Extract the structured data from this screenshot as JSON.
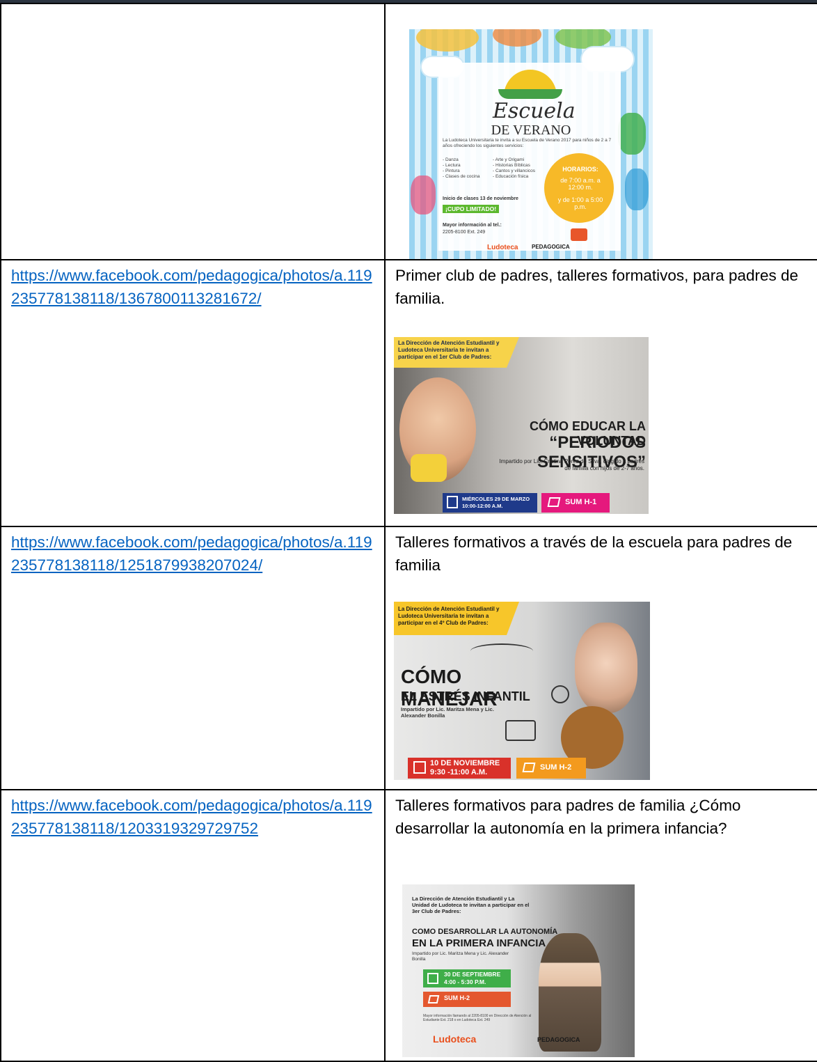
{
  "rows": [
    {
      "link": "",
      "description": "",
      "poster": {
        "kind": "escuela-verano",
        "script_title": "Escuela",
        "title": "DE VERANO",
        "intro": "La Ludoteca Universitaria te invita a su Escuela de Verano 2017 para niños de 2 a 7 años ofreciendo los siguientes servicios:",
        "services_left": [
          "- Danza",
          "- Lectura",
          "- Pintura",
          "- Clases de cocina"
        ],
        "services_right": [
          "- Arte y Origami",
          "- Historias Bíblicas",
          "- Cantos y villancicos",
          "- Educación física"
        ],
        "horarios_label": "HORARIOS:",
        "horarios_1": "de 7:00 a.m. a 12:00 m.",
        "horarios_2": "y de 1:00 a 5:00 p.m.",
        "start": "Inicio de clases 13 de noviembre",
        "limited": "¡CUPO LIMITADO!",
        "info_label": "Mayor información al tel.:",
        "info_phone": "2205-8100 Ext. 249",
        "logo_ludoteca": "Ludoteca",
        "logo_pedagogica": "PEDAGOGICA"
      }
    },
    {
      "link": "https://www.facebook.com/pedagogica/photos/a.119235778138118/1367800113281672/",
      "description": "Primer club de padres, talleres formativos, para padres de familia.",
      "poster": {
        "kind": "club-1",
        "banner": "La Dirección de Atención Estudiantil y Ludoteca Universitaria te invitan a participar en el 1er Club de Padres:",
        "headline1": "CÓMO EDUCAR LA VOLUNTAD",
        "headline2": "“PERIODOS SENSITIVOS”",
        "byline": "Impartido por Lic. Cristina Pérez de Silva, dirigido a padres de familia con hijos de 2-7 años.",
        "date": "MIÉRCOLES 29 DE MARZO",
        "time": "10:00-12:00 A.M.",
        "place": "SUM H-1"
      }
    },
    {
      "link": "https://www.facebook.com/pedagogica/photos/a.119235778138118/1251879938207024/",
      "description": "Talleres formativos a través de la escuela para padres de familia",
      "poster": {
        "kind": "club-4",
        "banner": "La Dirección de Atención Estudiantil y Ludoteca Universitaria te invitan a participar en el 4º Club de Padres:",
        "headline1": "CÓMO MANEJAR",
        "headline2": "EL ESTRÉS INFANTIL",
        "byline": "Impartido por Lic. Maritza Mena y Lic. Alexander Bonilla",
        "date": "10 DE NOVIEMBRE",
        "time": "9:30 -11:00 A.M.",
        "place": "SUM H-2"
      }
    },
    {
      "link": "https://www.facebook.com/pedagogica/photos/a.119235778138118/1203319329729752",
      "description": "Talleres formativos para padres de familia ¿Cómo desarrollar la autonomía en la primera infancia?",
      "poster": {
        "kind": "club-3",
        "banner": "La Dirección de Atención Estudiantil y La Unidad de Ludoteca te invitan a participar en el 3er Club de Padres:",
        "headline1": "COMO DESARROLLAR LA AUTONOMÍA",
        "headline2": "EN LA PRIMERA INFANCIA",
        "byline": "Impartido por Lic. Maritza Mena y Lic. Alexander Bonilla",
        "date": "30 DE SEPTIEMBRE",
        "time": "4:00 - 5:30 P.M.",
        "place": "SUM H-2",
        "info": "Mayor información llamando al 2205-8100 en Dirección de Atención al Estudiante Ext. 218 o en Ludoteca Ext. 249",
        "logo_ludoteca": "Ludoteca",
        "logo_pedagogica": "PEDAGOGICA"
      }
    }
  ]
}
